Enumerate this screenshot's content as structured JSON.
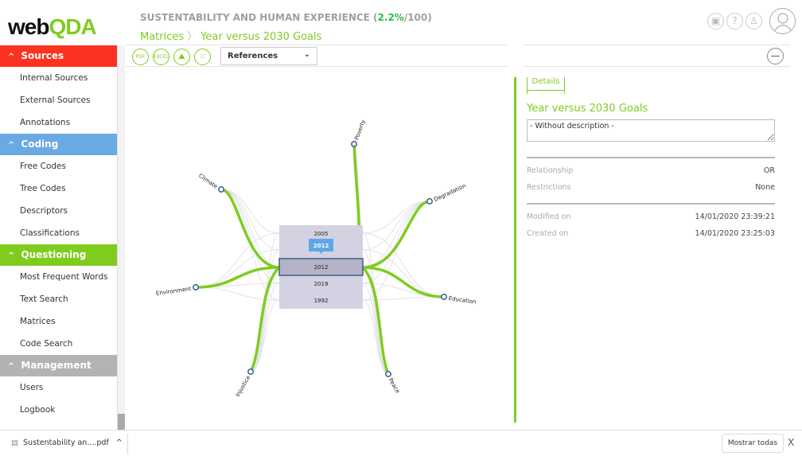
{
  "logo": {
    "text_a": "web",
    "text_b": "QDA"
  },
  "header": {
    "project": "SUSTENTABILITY AND HUMAN EXPERIENCE",
    "pct_open": " (",
    "pct": "2.2%",
    "pct_rest": "/100)",
    "crumb_parent": "Matrices",
    "crumb_sep": "〉",
    "crumb_current": "Year versus 2030 Goals",
    "icons": [
      "video-icon",
      "help-icon",
      "award-icon",
      "user-avatar-icon"
    ]
  },
  "sidebar": [
    {
      "label": "Sources",
      "color": "#fa3420",
      "items": [
        "Internal Sources",
        "External Sources",
        "Annotations"
      ]
    },
    {
      "label": "Coding",
      "color": "#6aaae2",
      "items": [
        "Free Codes",
        "Tree Codes",
        "Descriptors",
        "Classifications"
      ]
    },
    {
      "label": "Questioning",
      "color": "#7fcc1f",
      "items": [
        "Most Frequent Words",
        "Text Search",
        "Matrices",
        "Code Search"
      ]
    },
    {
      "label": "Management",
      "color": "#b3b3b3",
      "items": [
        "Users",
        "Logbook"
      ]
    }
  ],
  "toolbar": {
    "buttons": [
      "PDF",
      "EXCEL",
      "image",
      "grid"
    ],
    "select_value": "References"
  },
  "diagram": {
    "years": [
      "2005",
      "2012",
      "2019",
      "1992"
    ],
    "selected": "2012",
    "tooltip": "2012",
    "goals": [
      "Poverty",
      "Climate",
      "Degradation",
      "Environment",
      "Education",
      "Injustice",
      "Peace"
    ],
    "accent": "#7fcc1f"
  },
  "details": {
    "tab": "Details",
    "title": "Year versus 2030 Goals",
    "description": "- Without description -",
    "rows1": [
      {
        "k": "Relationship",
        "v": "OR"
      },
      {
        "k": "Restrictions",
        "v": "None"
      }
    ],
    "rows2": [
      {
        "k": "Modified on",
        "v": "14/01/2020 23:39:21"
      },
      {
        "k": "Created on",
        "v": "14/01/2020 23:25:03"
      }
    ]
  },
  "download": {
    "file": "Sustentability an....pdf",
    "caret": "^",
    "show_all": "Mostrar todas",
    "close": "X"
  }
}
